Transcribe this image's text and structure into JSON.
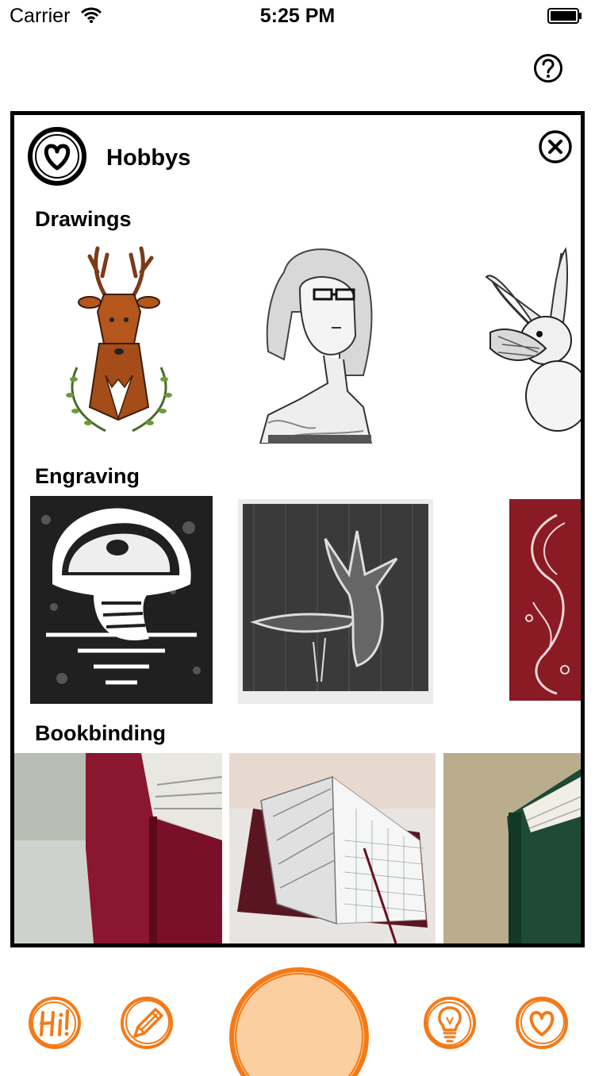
{
  "status_bar": {
    "carrier": "Carrier",
    "time": "5:25 PM",
    "wifi_icon": "wifi-icon",
    "battery_icon": "battery-icon"
  },
  "top_bar": {
    "help_icon": "question-mark-icon"
  },
  "card": {
    "icon": "heart-circle-icon",
    "title": "Hobbys",
    "close_icon": "close-x-icon",
    "sections": [
      {
        "title": "Drawings",
        "items": [
          "deer-drawing",
          "girl-portrait-drawing",
          "rabbit-drawing"
        ]
      },
      {
        "title": "Engraving",
        "items": [
          "mushroom-engraving",
          "leaf-engraving",
          "red-swirl-engraving"
        ]
      },
      {
        "title": "Bookbinding",
        "items": [
          "red-book-photo",
          "grid-notebook-photo",
          "green-book-photo"
        ]
      }
    ]
  },
  "tab_bar": {
    "accent": "#f47a17",
    "center_fill": "#fccfa0",
    "items": [
      "hi-icon",
      "pencil-icon",
      "home-button",
      "lightbulb-icon",
      "heart-icon"
    ]
  }
}
